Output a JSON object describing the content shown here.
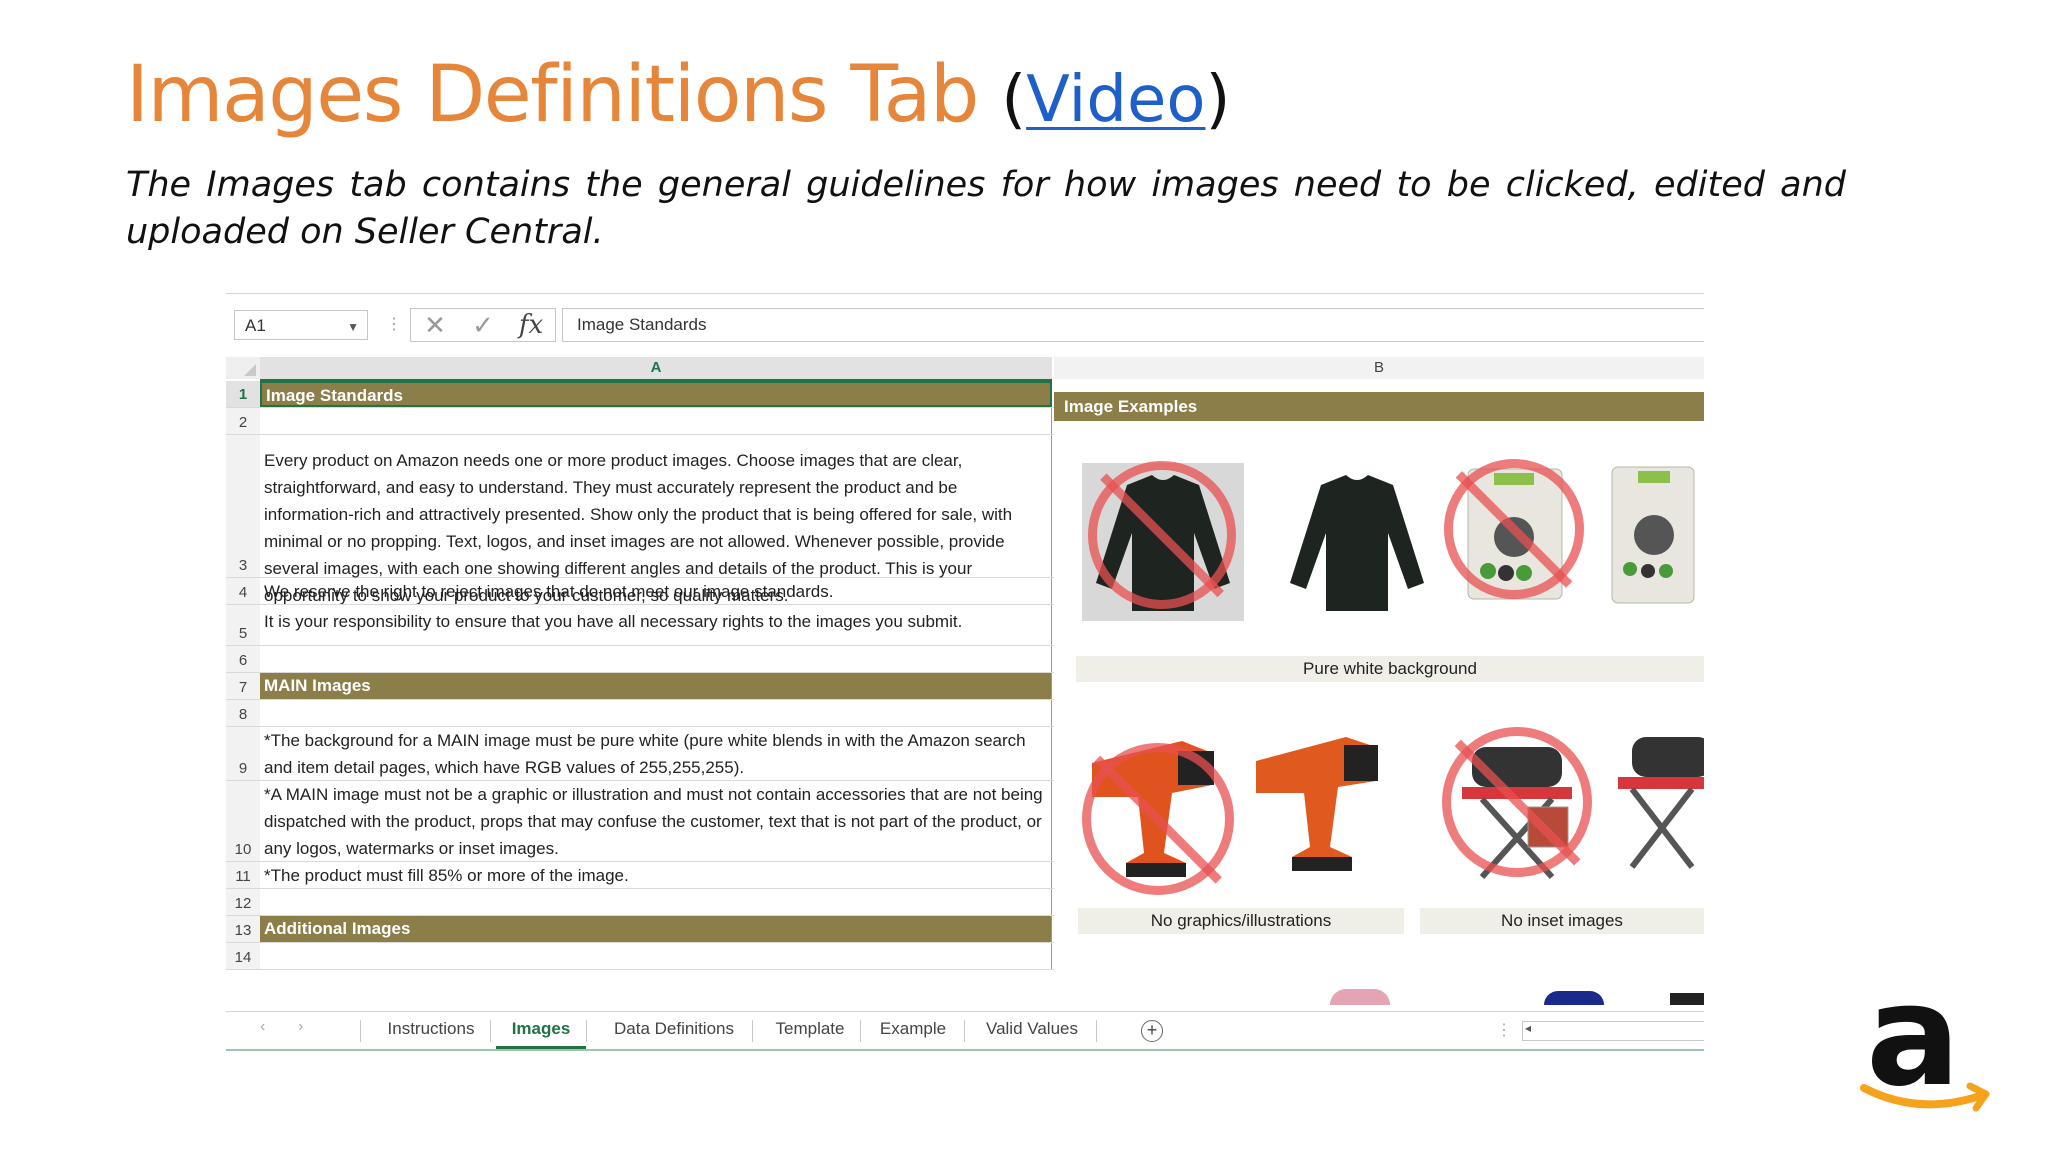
{
  "slide": {
    "title": "Images Definitions Tab",
    "link_open": "(",
    "link_text": "Video",
    "link_close": ")",
    "description": "The Images tab contains the general guidelines for how images need to be clicked, edited and uploaded on Seller Central."
  },
  "excel": {
    "name_box": "A1",
    "formula_separator": "⋮",
    "cancel_icon": "✕",
    "enter_icon": "✓",
    "fx_label": "fx",
    "formula_value": "Image Standards",
    "column_headers": [
      "A",
      "B"
    ],
    "rows": [
      {
        "num": "1",
        "text": "Image Standards"
      },
      {
        "num": "2",
        "text": ""
      },
      {
        "num": "3",
        "text": "Every product on Amazon needs one or more product images. Choose images that are clear, straightforward, and easy to understand. They must accurately represent the product and be information-rich and attractively presented. Show only the product that is being offered for sale, with minimal or no propping. Text, logos, and inset images are not allowed. Whenever possible, provide several images, with each one showing different angles and details of the product. This is your opportunity to show your product to your customer, so quality matters."
      },
      {
        "num": "4",
        "text": "We reserve the right to reject images that do not meet our image standards."
      },
      {
        "num": "5",
        "text": "It is your responsibility to ensure that you have all necessary rights to the images you submit."
      },
      {
        "num": "6",
        "text": ""
      },
      {
        "num": "7",
        "text": "MAIN Images"
      },
      {
        "num": "8",
        "text": ""
      },
      {
        "num": "9",
        "text": "*The background for a MAIN image must be pure white (pure white blends in with the Amazon search and item detail pages, which have RGB  values of 255,255,255)."
      },
      {
        "num": "10",
        "text": "*A MAIN image must not be a graphic or illustration and must not contain accessories that are not being dispatched with the product, props that may confuse the customer, text that is not part of the product, or any logos, watermarks or inset images."
      },
      {
        "num": "11",
        "text": "*The product must fill 85% or more of the image."
      },
      {
        "num": "12",
        "text": ""
      },
      {
        "num": "13",
        "text": "Additional Images"
      },
      {
        "num": "14",
        "text": ""
      }
    ],
    "column_b": {
      "header": "Image Examples",
      "caption_white_bg": "Pure white background",
      "caption_graphics": "No graphics/illustrations",
      "caption_inset": "No inset images"
    },
    "tabs": [
      "Instructions",
      "Images",
      "Data Definitions",
      "Template",
      "Example",
      "Valid Values"
    ],
    "active_tab": "Images",
    "add_sheet": "+",
    "nav_prev": "‹",
    "nav_next": "›",
    "scroll_icon": "◂"
  },
  "colors": {
    "title": "#e6863a",
    "link": "#1f5fc9",
    "section_header": "#8c7e48",
    "excel_green": "#217346",
    "amazon_orange": "#f7a21b"
  },
  "icons": [
    "caret-down-icon",
    "cancel-icon",
    "enter-icon",
    "fx-icon",
    "add-sheet-icon",
    "amazon-logo"
  ]
}
